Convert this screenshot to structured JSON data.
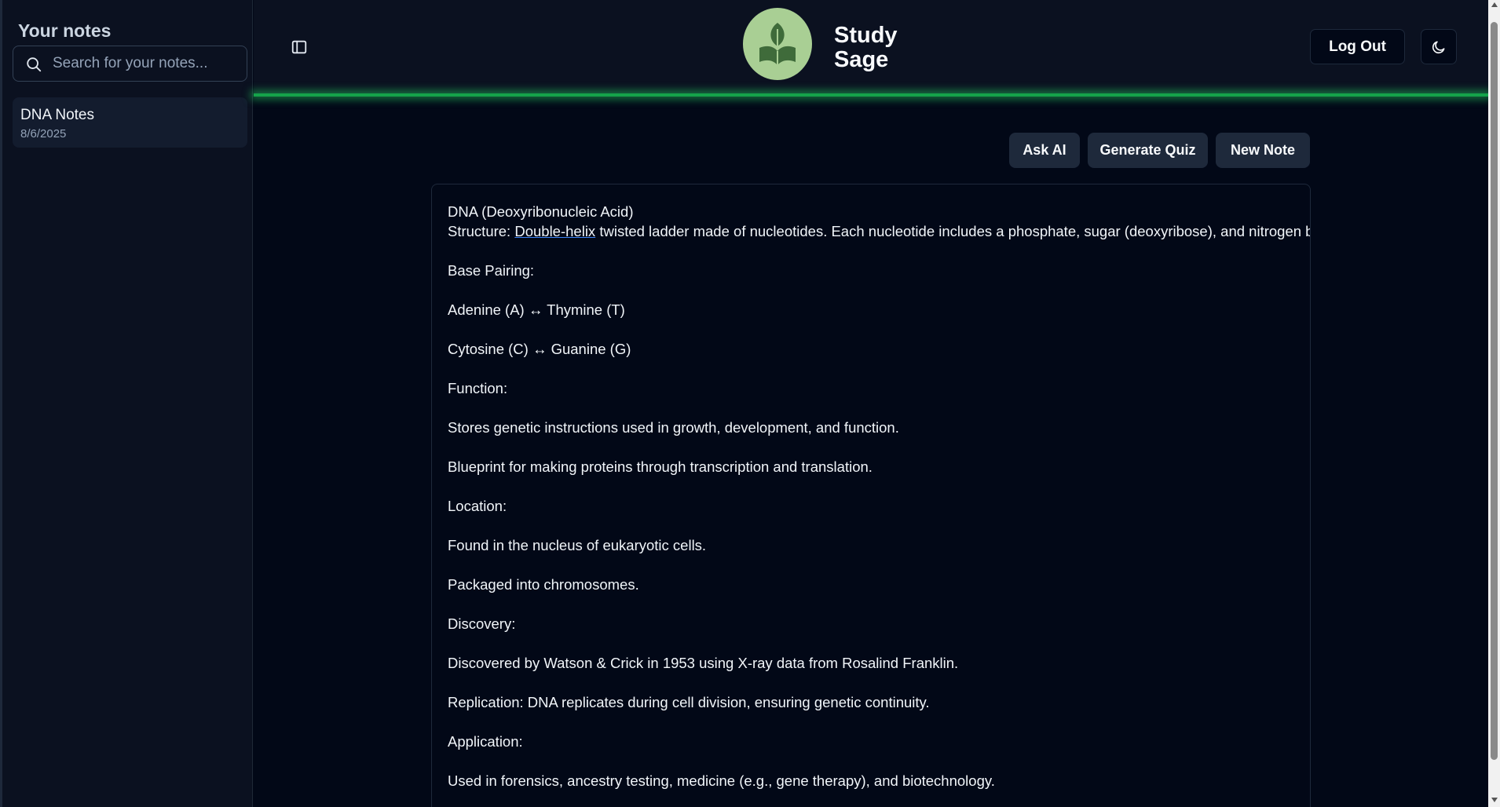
{
  "sidebar": {
    "title": "Your notes",
    "search_placeholder": "Search for your notes...",
    "notes": [
      {
        "title": "DNA Notes",
        "date": "8/6/2025"
      }
    ]
  },
  "header": {
    "brand_line1": "Study",
    "brand_line2": "Sage",
    "logout_label": "Log Out",
    "logo_icon": "leaf-book-icon",
    "theme_icon": "moon-icon",
    "sidebar_toggle_icon": "panel-left-icon"
  },
  "actions": {
    "ask_ai": "Ask AI",
    "generate_quiz": "Generate Quiz",
    "new_note": "New Note"
  },
  "note": {
    "line1": "DNA (Deoxyribonucleic Acid)",
    "structure_prefix": "Structure: ",
    "structure_link": "Double-helix",
    "structure_rest": " twisted ladder made of nucleotides. Each nucleotide includes a phosphate, sugar (deoxyribose), and nitrogen base.",
    "lines": [
      "Base Pairing:",
      "Adenine (A) ↔ Thymine (T)",
      "Cytosine (C) ↔ Guanine (G)",
      "Function:",
      "Stores genetic instructions used in growth, development, and function.",
      "Blueprint for making proteins through transcription and translation.",
      "Location:",
      "Found in the nucleus of eukaryotic cells.",
      "Packaged into chromosomes.",
      "Discovery:",
      "Discovered by Watson & Crick in 1953 using X-ray data from Rosalind Franklin.",
      "Replication: DNA replicates during cell division, ensuring genetic continuity.",
      "Application:",
      "Used in forensics, ancestry testing, medicine (e.g., gene therapy), and biotechnology."
    ]
  },
  "colors": {
    "background": "#020817",
    "panel": "#0b1120",
    "accent_green": "#22c55e",
    "logo_bg": "#a9cf94",
    "button_bg": "#1e293b"
  }
}
